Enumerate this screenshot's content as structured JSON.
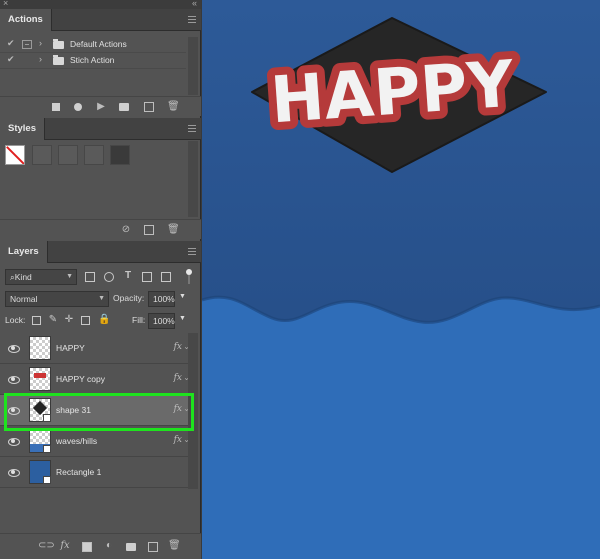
{
  "panels": {
    "actions": {
      "title": "Actions",
      "rows": [
        {
          "checked": true,
          "label": "Default Actions"
        },
        {
          "checked": true,
          "label": "Stich Action"
        }
      ],
      "footer_icons": [
        "stop-icon",
        "record-icon",
        "play-icon",
        "new-set-icon",
        "new-action-icon",
        "trash-icon"
      ]
    },
    "styles": {
      "title": "Styles",
      "footer_icons": [
        "clear-style-icon",
        "new-style-icon",
        "trash-icon"
      ]
    },
    "layers": {
      "title": "Layers",
      "filter_kind": "Kind",
      "blend_mode": "Normal",
      "opacity_label": "Opacity:",
      "opacity_value": "100%",
      "lock_label": "Lock:",
      "fill_label": "Fill:",
      "fill_value": "100%",
      "fx_label": "fx",
      "items": [
        {
          "name": "HAPPY",
          "has_fx": true,
          "selected": false
        },
        {
          "name": "HAPPY copy",
          "has_fx": true,
          "selected": false
        },
        {
          "name": "shape 31",
          "has_fx": true,
          "selected": true
        },
        {
          "name": "waves/hills",
          "has_fx": true,
          "selected": false
        },
        {
          "name": "Rectangle 1",
          "has_fx": false,
          "selected": false
        }
      ],
      "footer_icons": [
        "link-icon",
        "fx-icon",
        "mask-icon",
        "adjustment-icon",
        "group-folder-icon",
        "new-layer-icon",
        "trash-icon"
      ],
      "footer_fx": "fx"
    }
  },
  "canvas": {
    "text": "HAPPY",
    "colors": {
      "sky": "#2a5591",
      "hills": "#2f6db8",
      "diamond": "#262626",
      "outline": "#b53a3a",
      "letters": "#f2f2f2"
    }
  },
  "colors": {
    "panel_bg": "#535353",
    "selection_highlight": "#1ee31e"
  }
}
